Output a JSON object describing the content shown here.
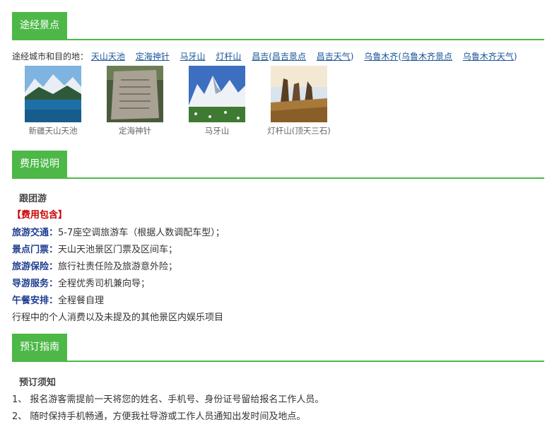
{
  "sections": {
    "route": "途经景点",
    "fees": "费用说明",
    "booking": "预订指南"
  },
  "cities": {
    "label": "途经城市和目的地：",
    "links": {
      "tianshan": "天山天池",
      "dinghai": "定海神针",
      "mayashan": "马牙山",
      "dengganshan": "灯杆山",
      "changji": "昌吉",
      "changji_spots": "昌吉景点",
      "changji_weather": "昌吉天气",
      "urumqi": "乌鲁木齐",
      "urumqi_spots": "乌鲁木齐景点",
      "urumqi_weather": "乌鲁木齐天气"
    }
  },
  "thumbs": [
    {
      "caption": "新疆天山天池"
    },
    {
      "caption": "定海神针"
    },
    {
      "caption": "马牙山"
    },
    {
      "caption": "灯杆山(顶天三石)"
    }
  ],
  "fees": {
    "tour_type": "跟团游",
    "included_title": "【费用包含】",
    "items": [
      {
        "label": "旅游交通：",
        "value": "5-7座空调旅游车（根据人数调配车型）；"
      },
      {
        "label": "景点门票：",
        "value": "天山天池景区门票及区间车；"
      },
      {
        "label": "旅游保险：",
        "value": "旅行社责任险及旅游意外险；"
      },
      {
        "label": "导游服务：",
        "value": "全程优秀司机兼向导；"
      },
      {
        "label": "午餐安排：",
        "value": "全程餐自理"
      }
    ],
    "excluded": "行程中的个人消费以及未提及的其他景区内娱乐项目"
  },
  "booking": {
    "title": "预订须知",
    "items": [
      "1、  报名游客需提前一天将您的姓名、手机号、身份证号留给报名工作人员。",
      "2、  随时保持手机畅通，方便我社导游或工作人员通知出发时间及地点。"
    ]
  }
}
